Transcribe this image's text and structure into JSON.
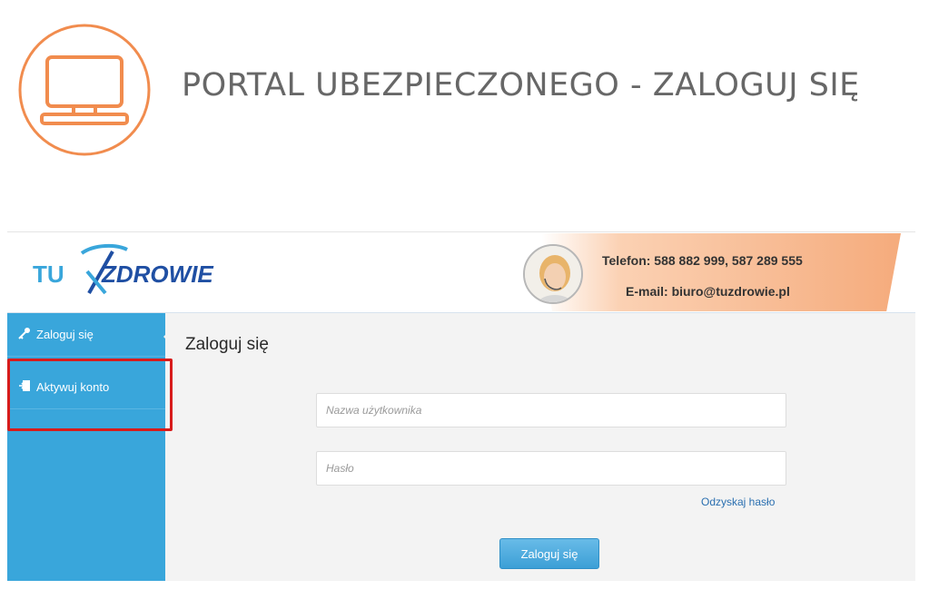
{
  "banner": {
    "title": "PORTAL UBEZPIECZONEGO - ZALOGUJ SIĘ",
    "icon": "monitor-icon",
    "accent_color": "#f18c4e"
  },
  "portal": {
    "logo": {
      "text_tu": "TU",
      "text_brand": "ZDROWIE",
      "color": "#1f4fa3"
    },
    "contact": {
      "phone": "Telefon: 588 882 999, 587 289 555",
      "email": "E-mail: biuro@tuzdrowie.pl",
      "band_color": "#f5ab7c"
    },
    "sidebar": {
      "color": "#39a6db",
      "items": [
        {
          "label": "Zaloguj się",
          "icon": "key-icon"
        },
        {
          "label": "Aktywuj konto",
          "icon": "door-icon"
        }
      ]
    },
    "main": {
      "title": "Zaloguj się",
      "username_placeholder": "Nazwa użytkownika",
      "password_placeholder": "Hasło",
      "recover_label": "Odzyskaj hasło",
      "submit_label": "Zaloguj się"
    },
    "highlight_color": "#d71b1b"
  }
}
